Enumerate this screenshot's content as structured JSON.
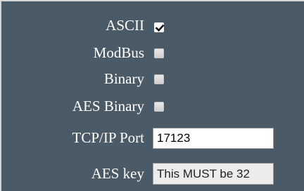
{
  "protocols": [
    {
      "label": "ASCII",
      "checked": true
    },
    {
      "label": "ModBus",
      "checked": false
    },
    {
      "label": "Binary",
      "checked": false
    },
    {
      "label": "AES Binary",
      "checked": false
    }
  ],
  "tcp_port": {
    "label": "TCP/IP Port",
    "value": "17123"
  },
  "aes_key": {
    "label": "AES key",
    "value": "This MUST be 32"
  },
  "colors": {
    "background": "#4a5a66",
    "label_text": "#ffffff",
    "input_bg": "#ffffff",
    "key_input_bg": "#ececec"
  }
}
